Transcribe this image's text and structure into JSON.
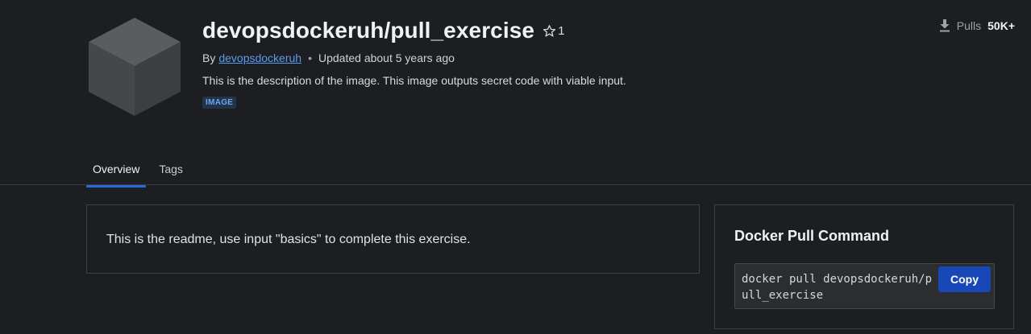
{
  "header": {
    "title": "devopsdockeruh/pull_exercise",
    "star_count": "1",
    "by_label": "By",
    "author": "devopsdockeruh",
    "updated": "Updated about 5 years ago",
    "description": "This is the description of the image. This image outputs secret code with viable input.",
    "badge": "IMAGE",
    "pulls_label": "Pulls",
    "pulls_count": "50K+"
  },
  "tabs": [
    {
      "label": "Overview",
      "active": true
    },
    {
      "label": "Tags",
      "active": false
    }
  ],
  "readme": {
    "text": "This is the readme, use input \"basics\" to complete this exercise."
  },
  "pull_command": {
    "title": "Docker Pull Command",
    "command": "docker pull devopsdockeruh/pull_exercise",
    "copy_label": "Copy"
  },
  "colors": {
    "background": "#1d1e22",
    "accent": "#1f6ce0",
    "link": "#5b9cf2",
    "copy_button": "#1a47b8"
  },
  "icons": [
    "cube-icon",
    "star-icon",
    "download-icon"
  ]
}
